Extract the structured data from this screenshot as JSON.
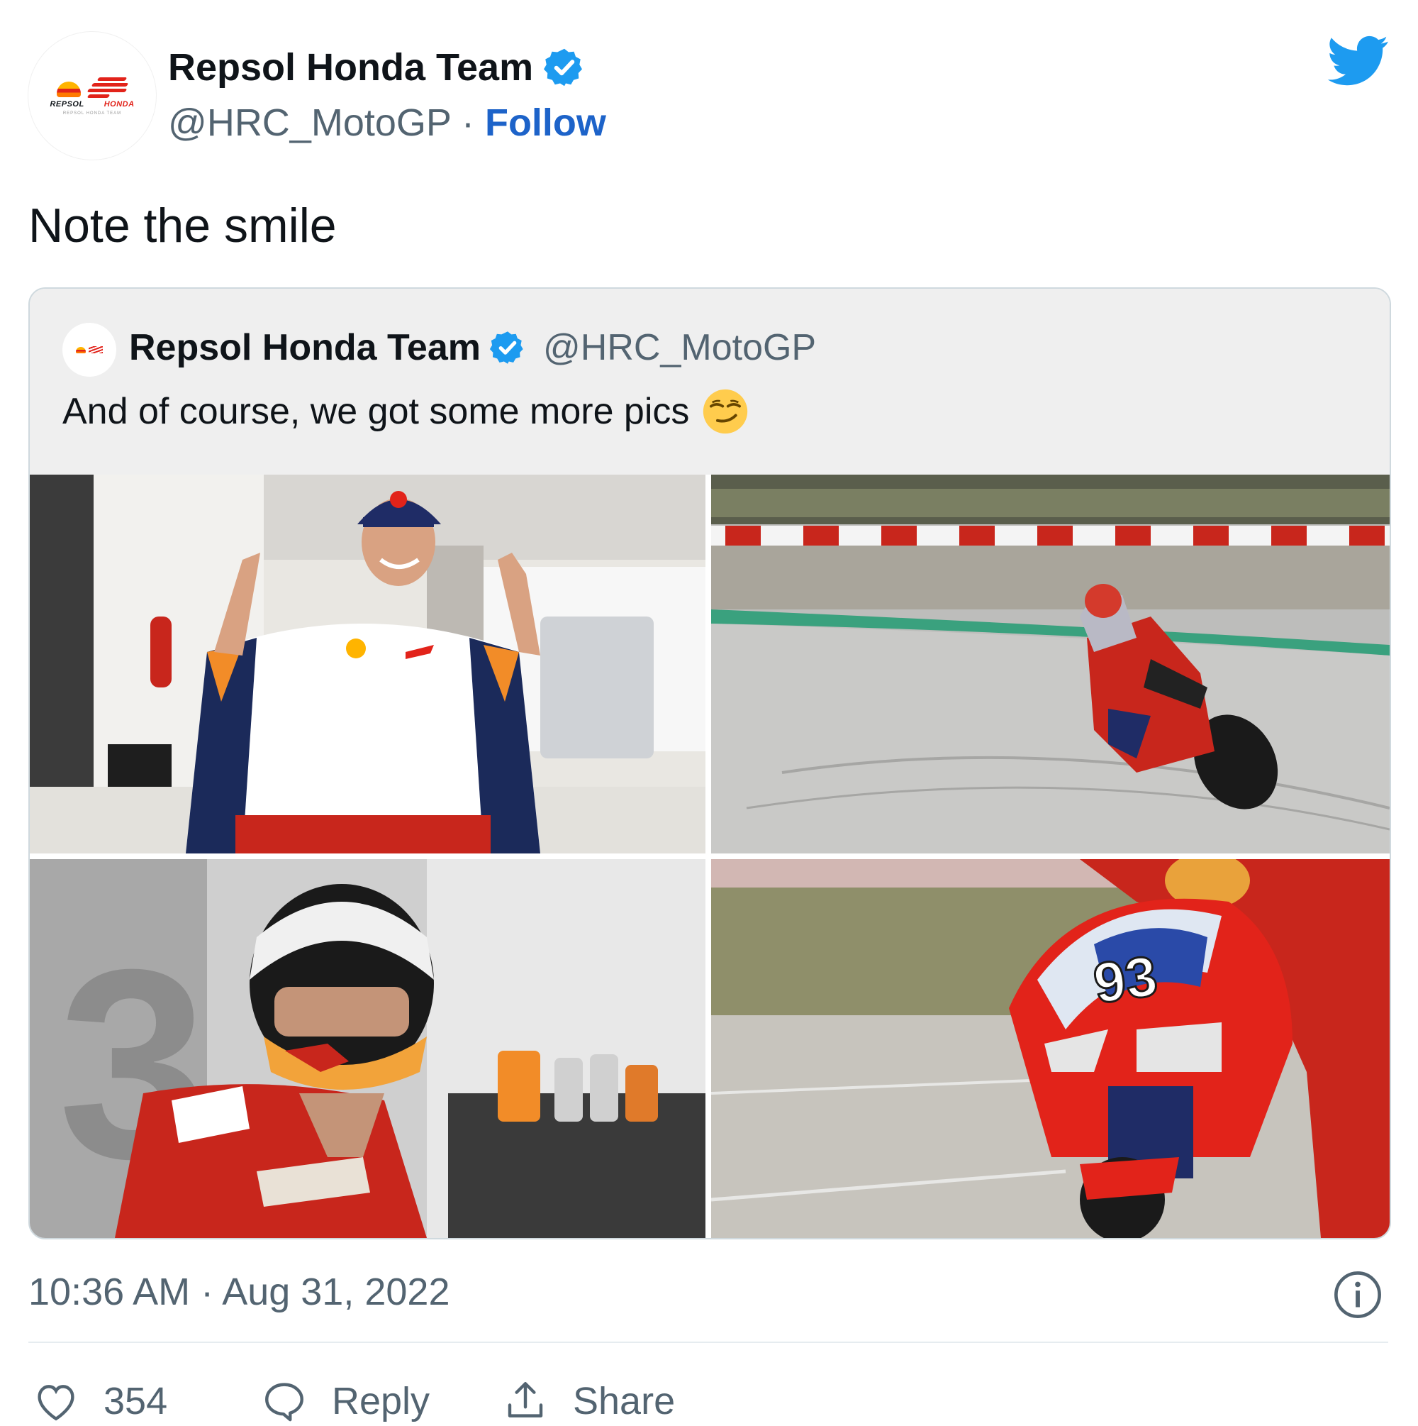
{
  "author": {
    "name": "Repsol Honda Team",
    "handle": "@HRC_MotoGP",
    "separator": "·",
    "follow_label": "Follow",
    "avatar": {
      "brand_left": "REPSOL",
      "brand_right": "HONDA",
      "brand_sub": "REPSOL HONDA TEAM"
    }
  },
  "tweet": {
    "text": "Note the smile"
  },
  "quoted_tweet": {
    "name": "Repsol Honda Team",
    "handle": "@HRC_MotoGP",
    "text": "And of course, we got some more pics",
    "emoji": "smirking-face-icon",
    "photos": [
      {
        "name": "rider-in-garage-photo"
      },
      {
        "name": "bike-cornering-on-track-photo"
      },
      {
        "name": "rider-putting-on-helmet-photo"
      },
      {
        "name": "bike-front-number-93-photo",
        "number_text": "93"
      }
    ]
  },
  "meta": {
    "time": "10:36 AM",
    "separator": "·",
    "date": "Aug 31, 2022"
  },
  "actions": {
    "likes": "354",
    "reply_label": "Reply",
    "share_label": "Share"
  },
  "colors": {
    "brand_blue": "#1d9bf0",
    "follow_blue": "#1d63c9",
    "secondary_text": "#536471",
    "honda_red": "#e2231a",
    "repsol_orange": "#ff7a00"
  }
}
